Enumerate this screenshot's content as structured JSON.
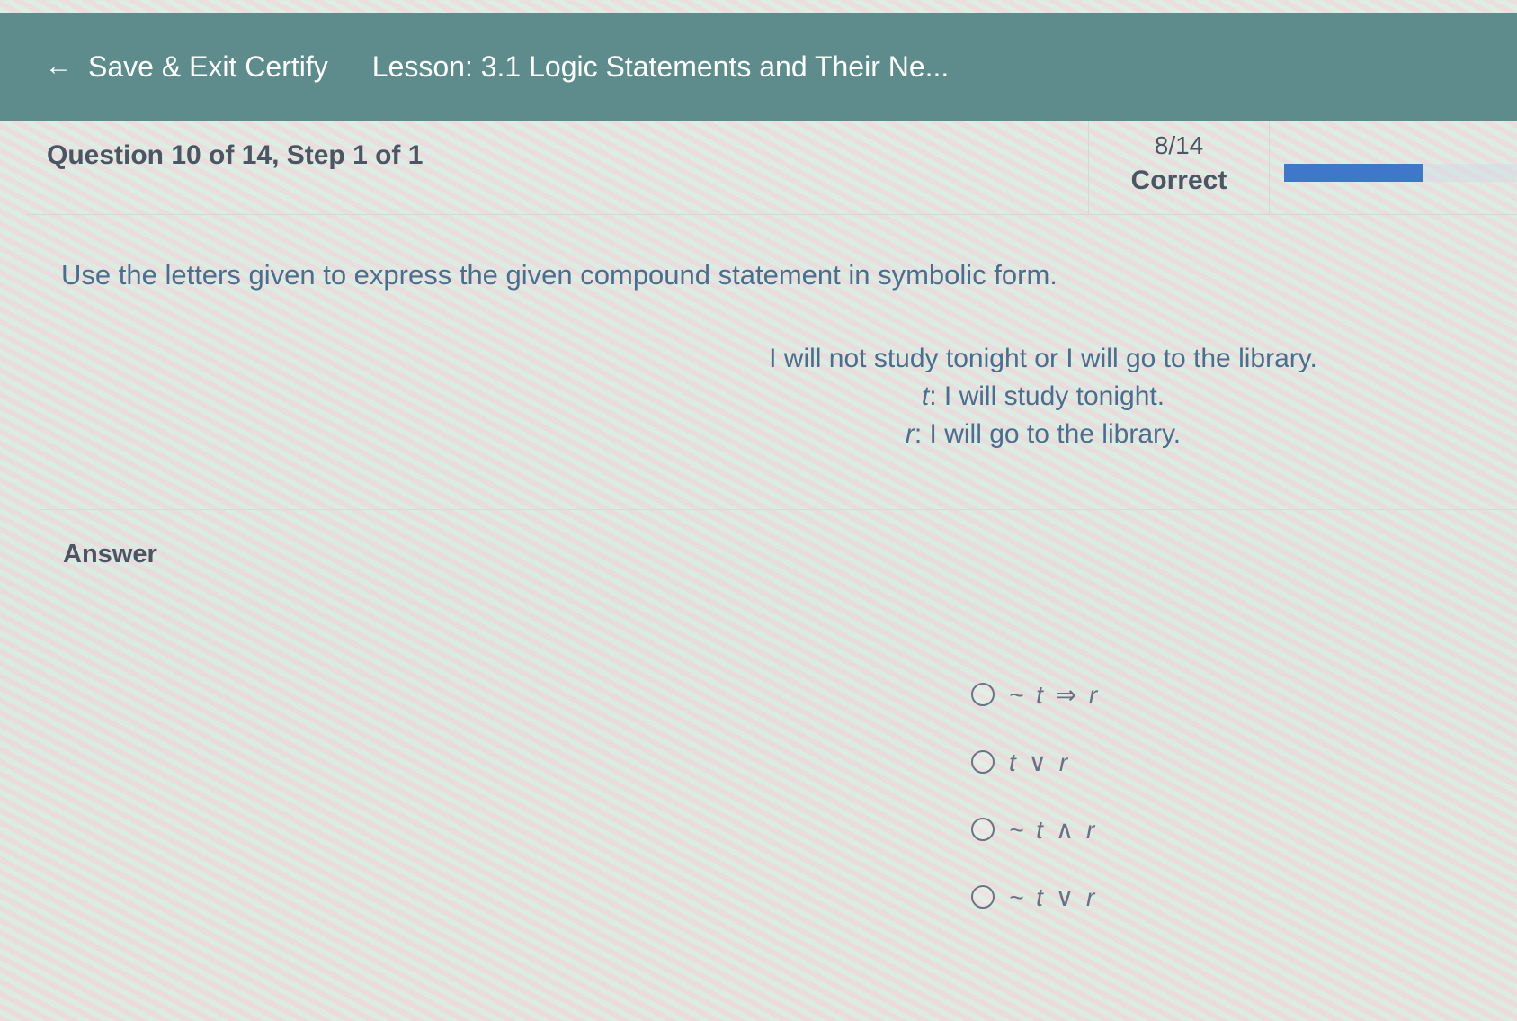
{
  "topbar": {
    "back_icon": "←",
    "back_label": "Save & Exit Certify",
    "lesson_title": "Lesson: 3.1 Logic Statements and Their Ne..."
  },
  "question": {
    "title": "Question 10 of 14, Step 1 of 1",
    "score_count": "8/14",
    "score_label": "Correct",
    "progress_fraction": 0.57
  },
  "prompt": {
    "instruction": "Use the letters given to express the given compound statement in symbolic form.",
    "statement": "I will not study tonight or I will go to the library.",
    "def_t_var": "t",
    "def_t_text": ": I will study tonight.",
    "def_r_var": "r",
    "def_r_text": ": I will go to the library."
  },
  "answer": {
    "label": "Answer",
    "options": [
      {
        "label": "~ t ⇒ r"
      },
      {
        "label": "t ∨ r"
      },
      {
        "label": "~ t ∧ r"
      },
      {
        "label": "~ t ∨ r"
      }
    ]
  },
  "colors": {
    "topbar": "#5e8c8c",
    "progress": "#3f78c9",
    "prompt_text": "#4b6e8f"
  },
  "icons": {
    "back": "arrow-left-icon",
    "radio": "radio-unchecked-icon"
  }
}
